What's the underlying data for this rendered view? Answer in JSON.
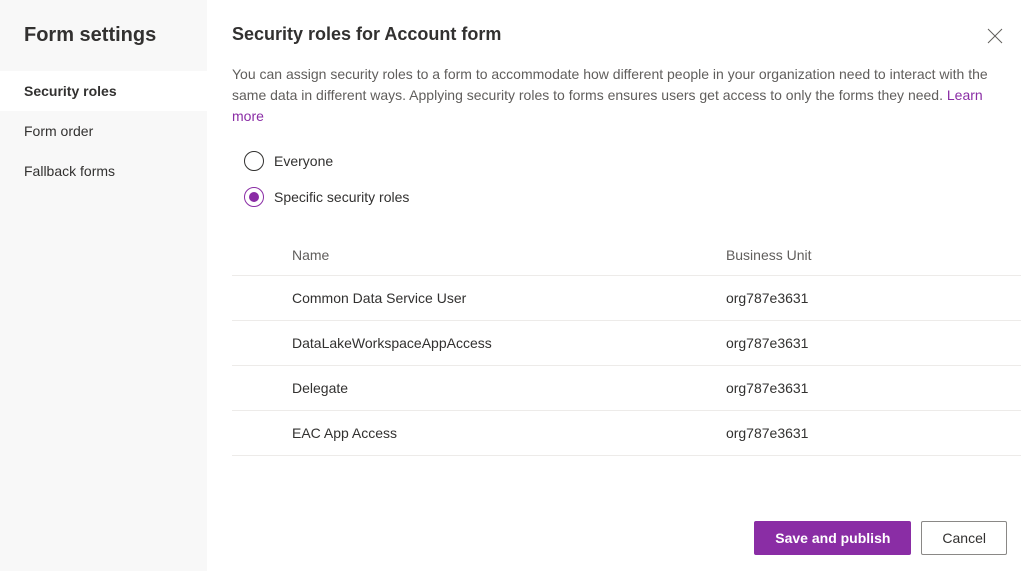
{
  "sidebar": {
    "title": "Form settings",
    "items": [
      {
        "label": "Security roles",
        "active": true
      },
      {
        "label": "Form order",
        "active": false
      },
      {
        "label": "Fallback forms",
        "active": false
      }
    ]
  },
  "header": {
    "title": "Security roles for Account form"
  },
  "description": {
    "text": "You can assign security roles to a form to accommodate how different people in your organization need to interact with the same data in different ways. Applying security roles to forms ensures users get access to only the forms they need. ",
    "learn_more": "Learn more"
  },
  "radios": {
    "everyone": "Everyone",
    "specific": "Specific security roles",
    "selected": "specific"
  },
  "table": {
    "headers": {
      "name": "Name",
      "business_unit": "Business Unit"
    },
    "rows": [
      {
        "name": "Common Data Service User",
        "business_unit": "org787e3631"
      },
      {
        "name": "DataLakeWorkspaceAppAccess",
        "business_unit": "org787e3631"
      },
      {
        "name": "Delegate",
        "business_unit": "org787e3631"
      },
      {
        "name": "EAC App Access",
        "business_unit": "org787e3631"
      }
    ]
  },
  "footer": {
    "save": "Save and publish",
    "cancel": "Cancel"
  }
}
